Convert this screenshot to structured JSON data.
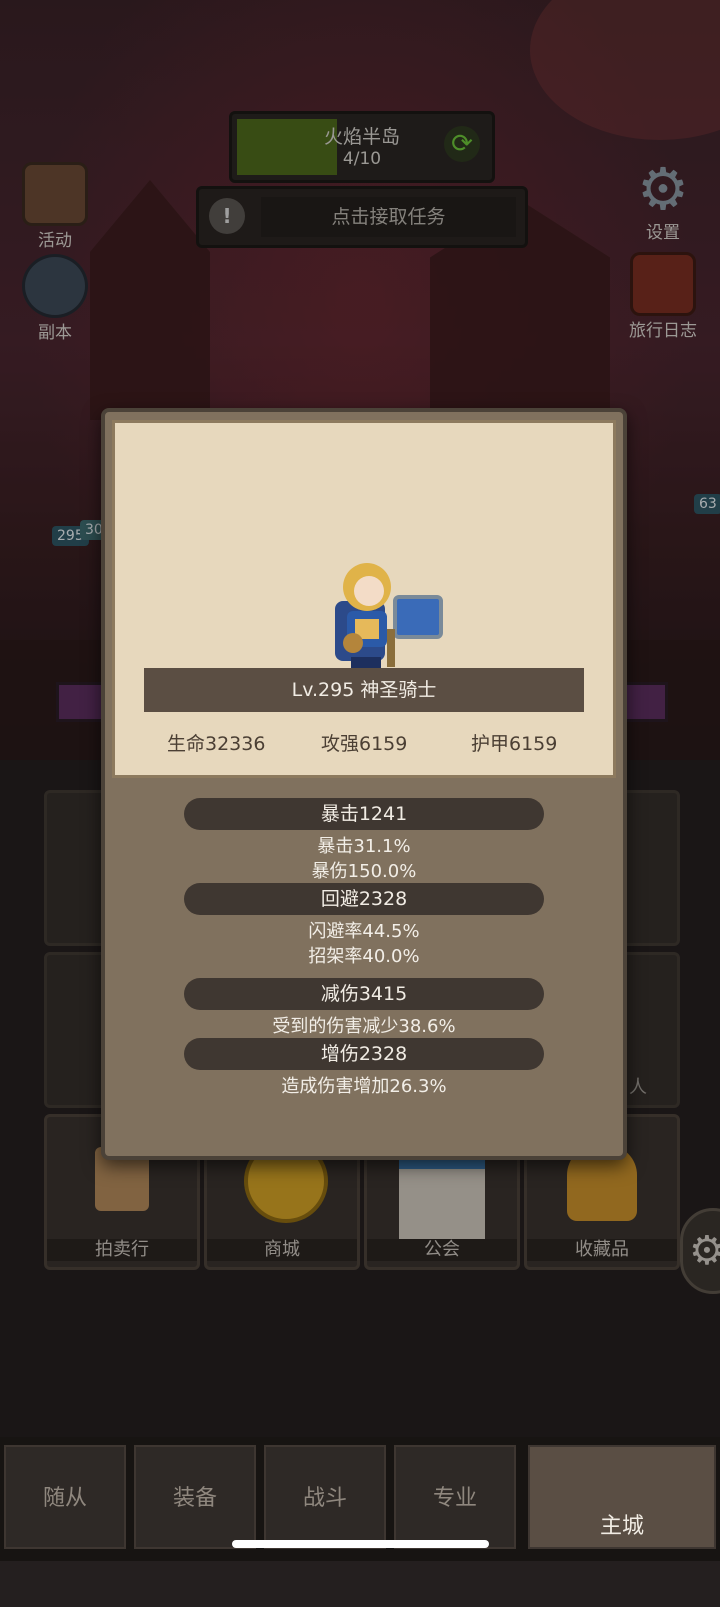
{
  "header": {
    "zone_name": "火焰半岛",
    "zone_progress": "4/10",
    "progress_fraction": 0.4,
    "task_prompt": "点击接取任务"
  },
  "left_menu": [
    {
      "label": "活动",
      "icon": "event-board-icon"
    },
    {
      "label": "副本",
      "icon": "dungeon-portal-icon"
    }
  ],
  "right_menu": [
    {
      "label": "设置",
      "icon": "gear-icon"
    },
    {
      "label": "旅行日志",
      "icon": "journal-icon"
    }
  ],
  "side_badges": {
    "left_a": "295",
    "left_b": "30",
    "right": "63"
  },
  "hero_card": {
    "name": "Lv.295 神圣骑士",
    "hp": "生命32336",
    "attack": "攻强6159",
    "armor": "护甲6159",
    "sections": [
      {
        "title": "暴击1241",
        "lines": [
          "暴击31.1%",
          "暴伤150.0%"
        ]
      },
      {
        "title": "回避2328",
        "lines": [
          "闪避率44.5%",
          "招架率40.0%"
        ]
      },
      {
        "title": "减伤3415",
        "lines": [
          "受到的伤害减少38.6%"
        ]
      },
      {
        "title": "增伤2328",
        "lines": [
          "造成伤害增加26.3%"
        ]
      }
    ]
  },
  "buildings": [
    {
      "label": "拍卖行",
      "icon": "trophy-icon"
    },
    {
      "label": "商城",
      "icon": "gold-coin-icon"
    },
    {
      "label": "公会",
      "icon": "guild-hall-icon"
    },
    {
      "label": "收藏品",
      "icon": "helmet-icon"
    }
  ],
  "partial_labels": {
    "right_row2": "人"
  },
  "nav_tabs": [
    "随从",
    "装备",
    "战斗",
    "专业",
    "主城"
  ],
  "active_tab": "主城",
  "colors": {
    "panel": "#80715e",
    "paper": "#e7d8bd",
    "progress_green": "#4e6a1d",
    "text_light": "#f1ece4"
  }
}
